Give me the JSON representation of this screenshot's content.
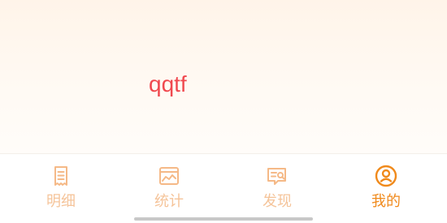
{
  "profile": {
    "username": "qqtf"
  },
  "tabbar": {
    "tabs": [
      {
        "label": "明细",
        "icon": "receipt-icon",
        "active": false
      },
      {
        "label": "统计",
        "icon": "chart-icon",
        "active": false
      },
      {
        "label": "发现",
        "icon": "discover-icon",
        "active": false
      },
      {
        "label": "我的",
        "icon": "user-profile-icon",
        "active": true
      }
    ]
  },
  "colors": {
    "accent": "#f08a1c",
    "inactive": "#f5c49a",
    "username": "#f0494f",
    "header_bg": "#fff4e9"
  }
}
